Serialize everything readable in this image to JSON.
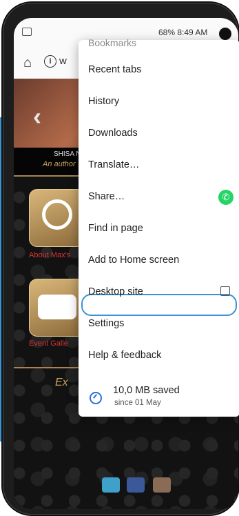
{
  "status_bar": {
    "time": "8:49 AM",
    "battery": "68%"
  },
  "url_bar": {
    "fragment": "w"
  },
  "page": {
    "brand_name": "SHISA N",
    "brand_tagline": "An author",
    "tile1_label": "About Max's",
    "tile2_label": "Event Galle",
    "script_text": "Ex"
  },
  "menu": {
    "cut_item": "Bookmarks",
    "items": [
      "Recent tabs",
      "History",
      "Downloads",
      "Translate…",
      "Share…",
      "Find in page",
      "Add to Home screen",
      "Desktop site",
      "Settings",
      "Help & feedback"
    ],
    "saved_title": "10,0 MB saved",
    "saved_sub": "since 01 May"
  },
  "colors": {
    "accent_blue": "#3b93d3",
    "whatsapp_green": "#25d366",
    "gold": "#a88550"
  }
}
